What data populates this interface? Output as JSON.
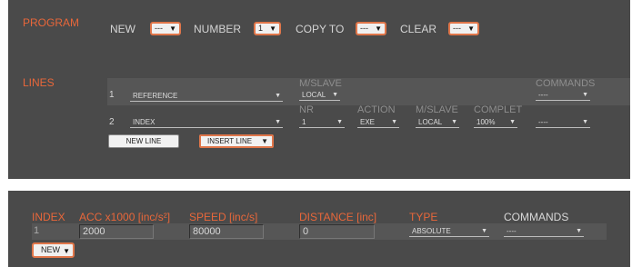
{
  "program": {
    "title": "PROGRAM",
    "new_label": "NEW",
    "new_value": "---",
    "number_label": "NUMBER",
    "number_value": "1",
    "copy_to_label": "COPY TO",
    "copy_to_value": "---",
    "clear_label": "CLEAR",
    "clear_value": "---"
  },
  "lines": {
    "title": "LINES",
    "line1": {
      "index": "1",
      "select": "REFERENCE",
      "mslave_header": "M/SLAVE",
      "mslave_value": "LOCAL",
      "commands_header": "COMMANDS",
      "commands_value": "----"
    },
    "line2": {
      "index": "2",
      "select": "INDEX",
      "nr_header": "NR",
      "nr_value": "1",
      "action_header": "ACTION",
      "action_value": "EXE",
      "mslave_header": "M/SLAVE",
      "mslave_value": "LOCAL",
      "complet_header": "COMPLET",
      "complet_value": "100%",
      "commands_value": "----"
    },
    "new_line_button": "NEW LINE",
    "insert_line_value": "INSERT LINE"
  },
  "index_table": {
    "headers": {
      "index": "INDEX",
      "acc": "ACC x1000 [inc/s²]",
      "speed": "SPEED [inc/s]",
      "distance": "DISTANCE [inc]",
      "type": "TYPE",
      "commands": "COMMANDS"
    },
    "row": {
      "index": "1",
      "acc": "2000",
      "speed": "80000",
      "distance": "0",
      "type": "ABSOLUTE",
      "commands": "----"
    },
    "new_value": "NEW"
  },
  "icons": {
    "dropdown": "caret-down-icon"
  },
  "colors": {
    "panel": "#4a4a4a",
    "accent": "#e8673a",
    "band": "#565656"
  }
}
